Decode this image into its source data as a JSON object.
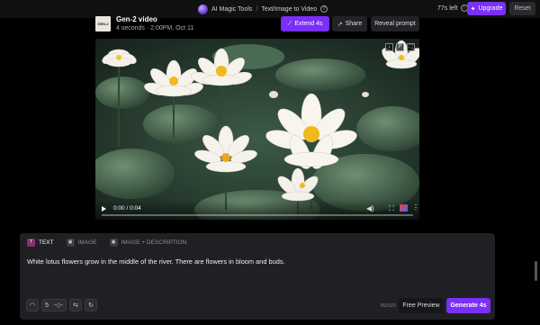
{
  "topbar": {
    "crumb_app": "AI Magic Tools",
    "crumb_sep": "/",
    "crumb_page": "Text/Image to Video",
    "credits": "77s left",
    "upgrade_label": "Upgrade",
    "reset_label": "Reset"
  },
  "video_header": {
    "thumb_text": "GEN-2",
    "title": "Gen-2 video",
    "meta": "4 seconds · 2:00PM, Oct 11",
    "extend_label": "Extend 4s",
    "share_label": "Share",
    "reveal_label": "Reveal prompt"
  },
  "player": {
    "time": "0:00 / 0:04",
    "progress": 0.0,
    "tool_labels": [
      "↓",
      "P",
      "⛶"
    ]
  },
  "panel": {
    "tabs": [
      {
        "label": "TEXT",
        "icon": "T"
      },
      {
        "label": "IMAGE",
        "icon": "▣"
      },
      {
        "label": "IMAGE + DESCRIPTION",
        "icon": "▣"
      }
    ],
    "prompt": "White lotus flowers grow in the middle of the river. There are flowers in bloom and buds.",
    "seed_value": "5",
    "counter": "89/320",
    "free_preview_label": "Free Preview",
    "generate_label": "Generate 4s"
  },
  "colors": {
    "accent": "#7b2ff7",
    "panel_bg": "#1f2024",
    "page_bg": "#000000"
  }
}
